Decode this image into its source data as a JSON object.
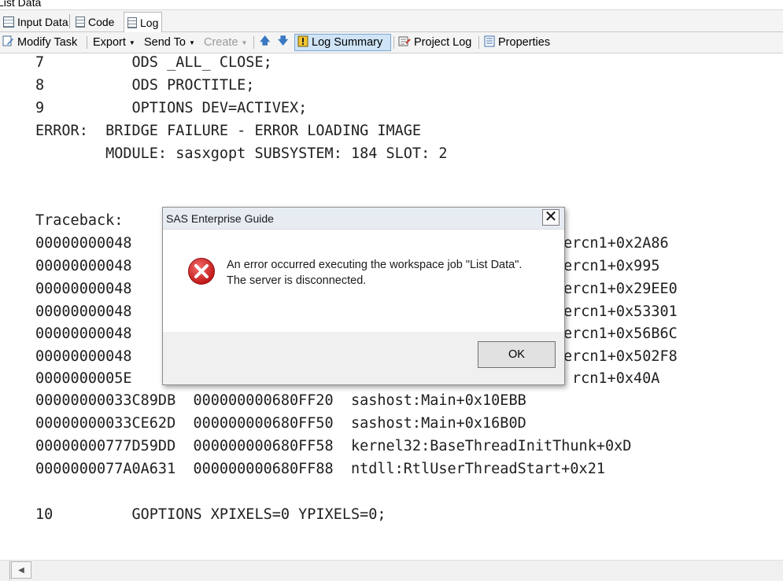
{
  "window": {
    "title": "List Data"
  },
  "tabs": [
    {
      "label": "Input Data"
    },
    {
      "label": "Code"
    },
    {
      "label": "Log"
    }
  ],
  "toolbar": {
    "modify_task": "Modify Task",
    "export": "Export",
    "send_to": "Send To",
    "create": "Create",
    "log_summary": "Log Summary",
    "project_log": "Project Log",
    "properties": "Properties"
  },
  "log_lines": [
    "7          ODS _ALL_ CLOSE;",
    "8          ODS PROCTITLE;",
    "9          OPTIONS DEV=ACTIVEX;",
    "ERROR:  BRIDGE FAILURE - ERROR LOADING IMAGE",
    "        MODULE: sasxgopt SUBSYSTEM: 184 SLOT: 2",
    "",
    "",
    "Traceback:",
    "00000000048",
    "00000000048",
    "00000000048",
    "00000000048",
    "00000000048",
    "00000000048",
    "0000000005E",
    "00000000033C89DB  000000000680FF20  sashost:Main+0x10EBB",
    "00000000033CE62D  000000000680FF50  sashost:Main+0x16B0D",
    "00000000777D59DD  000000000680FF58  kernel32:BaseThreadInitThunk+0xD",
    "0000000077A0A631  000000000680FF88  ntdll:RtlUserThreadStart+0x21",
    "",
    "10         GOPTIONS XPIXELS=0 YPIXELS=0;"
  ],
  "trace_right": [
    "ercn1+0x2A86",
    "ercn1+0x995",
    "ercn1+0x29EE0",
    "ercn1+0x53301",
    "ercn1+0x56B6C",
    "ercn1+0x502F8",
    "rcn1+0x40A"
  ],
  "dialog": {
    "title": "SAS Enterprise Guide",
    "close_glyph": "✕",
    "message_line1": "An error occurred executing the workspace job \"List Data\".",
    "message_line2": "The server is disconnected.",
    "ok_label": "OK"
  },
  "icons": {
    "error": "error-circle-icon",
    "up": "arrow-up-icon",
    "down": "arrow-down-icon"
  },
  "colors": {
    "error_red": "#d62828",
    "pressed_bg": "#cfe4f7",
    "dialog_title_bg": "#e7ecf3"
  }
}
